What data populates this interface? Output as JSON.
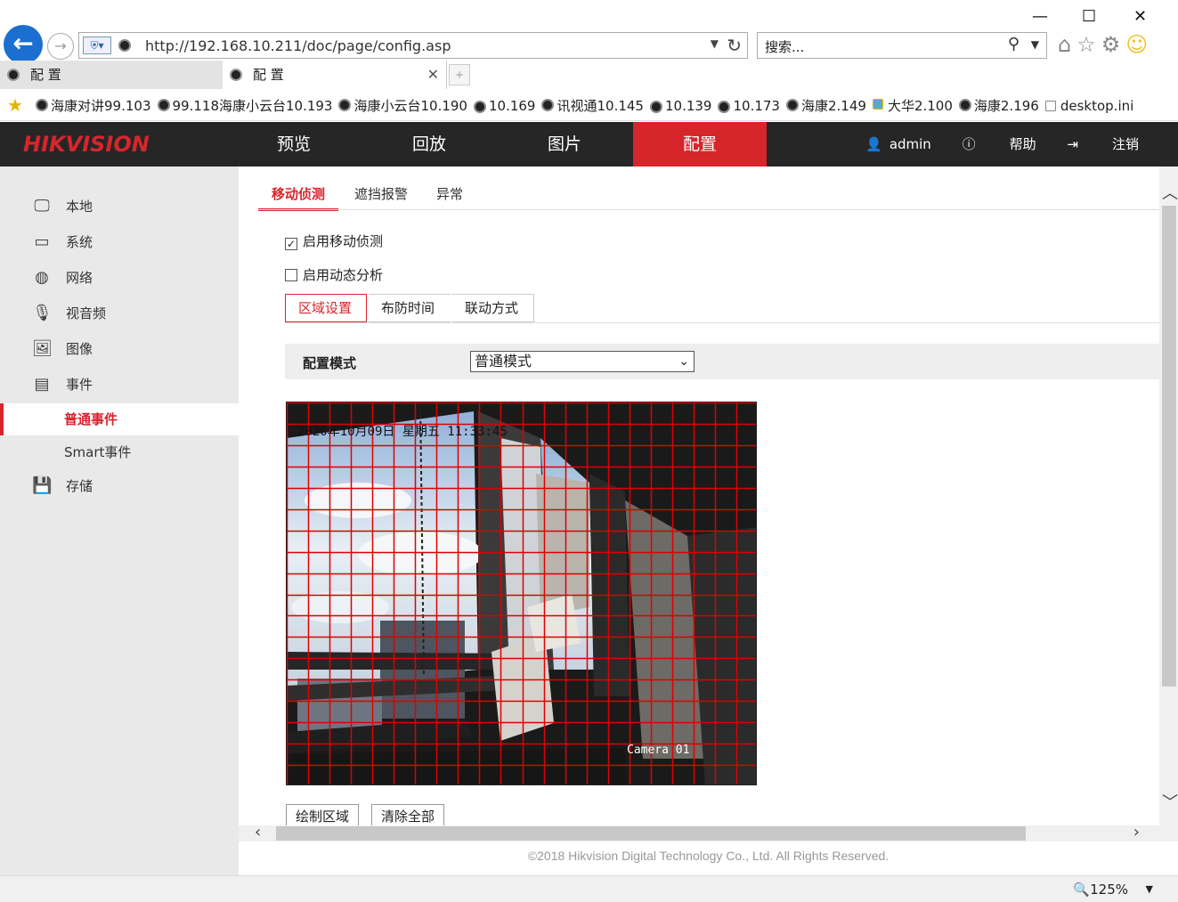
{
  "browser": {
    "address_url": "http://192.168.10.211/doc/page/config.asp",
    "search_placeholder": "搜索...",
    "tabs": [
      {
        "label": "配 置"
      },
      {
        "label": "配 置"
      }
    ],
    "favorites": [
      {
        "label": "海康对讲99.103",
        "type": "cam"
      },
      {
        "label": "99.118海康小云台10.193",
        "type": "cam"
      },
      {
        "label": "海康小云台10.190",
        "type": "cam"
      },
      {
        "label": "10.169",
        "type": "cam"
      },
      {
        "label": "讯视通10.145",
        "type": "cam"
      },
      {
        "label": "10.139",
        "type": "cam"
      },
      {
        "label": "10.173",
        "type": "cam"
      },
      {
        "label": "海康2.149",
        "type": "cam"
      },
      {
        "label": "大华2.100",
        "type": "ie"
      },
      {
        "label": "海康2.196",
        "type": "cam"
      },
      {
        "label": "desktop.ini",
        "type": "doc"
      }
    ],
    "zoom": "125%"
  },
  "header": {
    "logo": "HIKVISION",
    "nav": [
      {
        "label": "预览"
      },
      {
        "label": "回放"
      },
      {
        "label": "图片"
      },
      {
        "label": "配置",
        "active": true
      }
    ],
    "user": "admin",
    "help": "帮助",
    "logout": "注销",
    "accent_color": "#d7252c"
  },
  "sidebar": {
    "items": [
      {
        "label": "本地",
        "icon": "monitor-icon"
      },
      {
        "label": "系统",
        "icon": "system-icon"
      },
      {
        "label": "网络",
        "icon": "globe-icon"
      },
      {
        "label": "视音频",
        "icon": "audio-video-icon"
      },
      {
        "label": "图像",
        "icon": "image-icon"
      },
      {
        "label": "事件",
        "icon": "calendar-icon"
      }
    ],
    "event_sub": [
      {
        "label": "普通事件",
        "active": true
      },
      {
        "label": "Smart事件"
      }
    ],
    "storage": {
      "label": "存储",
      "icon": "save-icon"
    }
  },
  "main": {
    "subtabs": [
      {
        "label": "移动侦测",
        "active": true
      },
      {
        "label": "遮挡报警"
      },
      {
        "label": "异常"
      }
    ],
    "enable_motion": {
      "label": "启用移动侦测",
      "checked": true
    },
    "enable_dynamic": {
      "label": "启用动态分析",
      "checked": false
    },
    "steps": [
      {
        "label": "区域设置",
        "active": true
      },
      {
        "label": "布防时间"
      },
      {
        "label": "联动方式"
      }
    ],
    "config_mode": {
      "label": "配置模式",
      "value": "普通模式"
    },
    "video": {
      "timestamp": "2020年10月09日 星期五 11:33:45",
      "camera_name": "Camera 01",
      "grid_cols": 22,
      "grid_rows": 18,
      "grid_color": "#e00000"
    },
    "draw_button": "绘制区域",
    "clear_button": "清除全部"
  },
  "footer": {
    "copyright": "©2018 Hikvision Digital Technology Co., Ltd. All Rights Reserved."
  }
}
